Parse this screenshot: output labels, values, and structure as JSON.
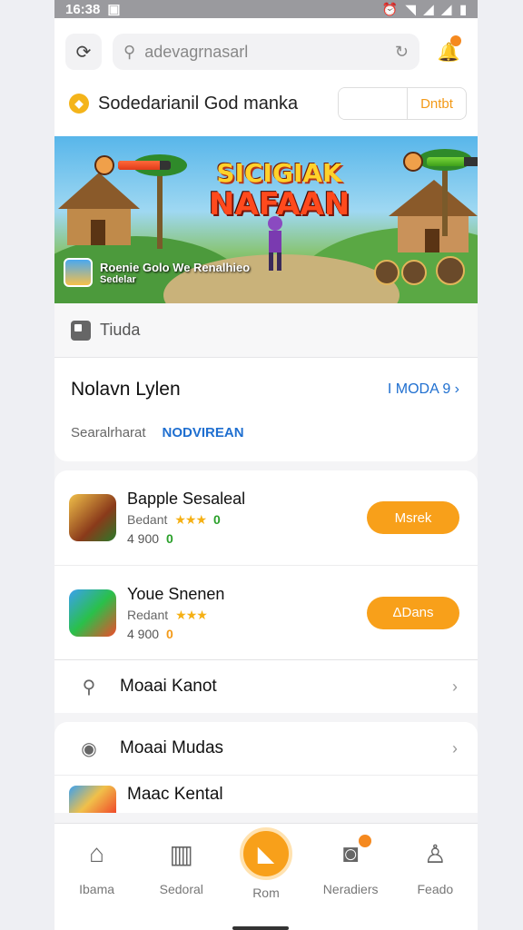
{
  "status": {
    "time": "16:38"
  },
  "search": {
    "placeholder": "adevagrnasarl"
  },
  "header": {
    "title": "Sodedarianil God manka",
    "button": "Dntbt"
  },
  "banner": {
    "title_line1": "SICIGIAK",
    "title_line2": "NAFAAN",
    "caption": "Roenie Golo We Renalhieo",
    "caption_sub": "Sedelar"
  },
  "section": {
    "label": "Tiuda"
  },
  "info": {
    "title": "Nolavn Lylen",
    "link": "I MODA 9",
    "key": "Searalrharat",
    "value": "NODVIREAN"
  },
  "apps": [
    {
      "name": "Bapple Sesaleal",
      "sub": "Bedant",
      "stars": "★★★",
      "rating": "0",
      "count": "4 900",
      "tag": "0",
      "button": "Msrek"
    },
    {
      "name": "Youe Snenen",
      "sub": "Redant",
      "stars": "★★★",
      "rating": "",
      "count": "4 900",
      "tag": "0",
      "button": "ΔDans"
    }
  ],
  "search_row": {
    "label": "Moaai Kanot"
  },
  "sections": [
    {
      "label": "Moaai Mudas"
    },
    {
      "label": "Maac Kental"
    }
  ],
  "tabs": [
    {
      "label": "Ibama"
    },
    {
      "label": "Sedoral"
    },
    {
      "label": "Rom"
    },
    {
      "label": "Neradiers"
    },
    {
      "label": "Feado"
    }
  ],
  "colors": {
    "accent": "#f8a01a",
    "link": "#1f6fd0",
    "banner_sky": "#58b6ea"
  }
}
